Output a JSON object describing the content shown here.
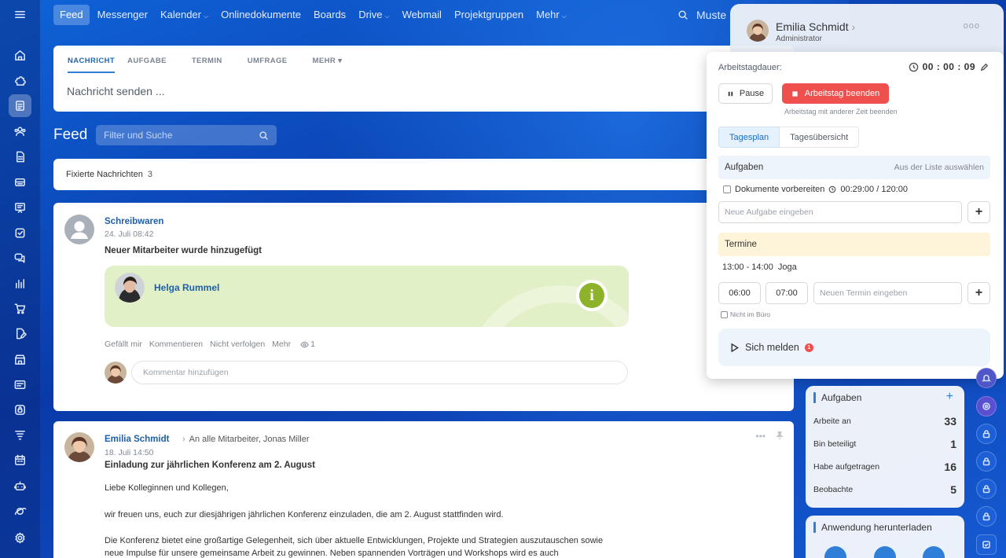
{
  "nav": {
    "items": [
      {
        "label": "Feed",
        "active": true,
        "caret": ""
      },
      {
        "label": "Messenger",
        "caret": ""
      },
      {
        "label": "Kalender",
        "caret": "⌵"
      },
      {
        "label": "Onlinedokumente",
        "caret": ""
      },
      {
        "label": "Boards",
        "caret": ""
      },
      {
        "label": "Drive",
        "caret": "⌵"
      },
      {
        "label": "Webmail",
        "caret": ""
      },
      {
        "label": "Projektgruppen",
        "caret": ""
      },
      {
        "label": "Mehr",
        "caret": "⌵"
      }
    ],
    "search_text": "Muste"
  },
  "composer": {
    "tabs": [
      "NACHRICHT",
      "AUFGABE",
      "TERMIN",
      "UMFRAGE",
      "MEHR ▾"
    ],
    "placeholder": "Nachricht senden ..."
  },
  "feed": {
    "title": "Feed",
    "filter_placeholder": "Filter und Suche",
    "pinned_label": "Fixierte Nachrichten",
    "pinned_count": "3"
  },
  "post1": {
    "author": "Schreibwaren",
    "date": "24. Juli 08:42",
    "title": "Neuer Mitarbeiter wurde hinzugefügt",
    "new_employee": "Helga Rummel",
    "actions": [
      "Gefällt mir",
      "Kommentieren",
      "Nicht verfolgen",
      "Mehr"
    ],
    "views": "1",
    "comment_placeholder": "Kommentar hinzufügen"
  },
  "post2": {
    "author": "Emilia Schmidt",
    "separator": "›",
    "recipients": "An alle Mitarbeiter, Jonas Miller",
    "date": "18. Juli 14:50",
    "title": "Einladung zur jährlichen Konferenz am 2. August",
    "body": [
      "Liebe Kolleginnen und Kollegen,",
      "wir freuen uns, euch zur diesjährigen jährlichen Konferenz einzuladen, die am 2. August stattfinden wird.",
      "Die Konferenz bietet eine großartige Gelegenheit, sich über aktuelle Entwicklungen, Projekte und Strategien auszutauschen sowie",
      "neue Impulse für unsere gemeinsame Arbeit zu gewinnen. Neben spannenden Vorträgen und Workshops wird es auch"
    ]
  },
  "user": {
    "name": "Emilia Schmidt",
    "chevron": "›",
    "role": "Administrator",
    "more": "ooo"
  },
  "workday": {
    "duration_label": "Arbeitstagdauer:",
    "timer": "00 : 00 : 09",
    "pause_label": "Pause",
    "end_label": "Arbeitstag beenden",
    "end_other_time": "Arbeitstag mit anderer Zeit beenden",
    "tabs": [
      "Tagesplan",
      "Tagesübersicht"
    ],
    "tasks_header": "Aufgaben",
    "tasks_link": "Aus der Liste auswählen",
    "task_item": "Dokumente vorbereiten",
    "task_time": "00:29:00 / 120:00",
    "new_task_placeholder": "Neue Aufgabe eingeben",
    "plus": "+",
    "events_header": "Termine",
    "event_time": "13:00 - 14:00",
    "event_name": "Joga",
    "time_from": "06:00",
    "time_to": "07:00",
    "new_event_placeholder": "Neuen Termin eingeben",
    "not_in_office": "Nicht im Büro",
    "checkin_label": "Sich melden",
    "checkin_badge": "1"
  },
  "tasks_widget": {
    "title": "Aufgaben",
    "plus": "+",
    "rows": [
      {
        "label": "Arbeite an",
        "count": "33"
      },
      {
        "label": "Bin beteiligt",
        "count": "1"
      },
      {
        "label": "Habe aufgetragen",
        "count": "16"
      },
      {
        "label": "Beobachte",
        "count": "5"
      }
    ]
  },
  "app_widget": {
    "title": "Anwendung herunterladen"
  },
  "colors": {
    "accent": "#2f7fd8",
    "danger": "#f0504d",
    "success": "#8cb32a"
  },
  "icons": {
    "left_rail": [
      "menu-icon",
      "home-icon",
      "puzzle-icon",
      "feed-icon",
      "team-icon",
      "document-icon",
      "inbox-icon",
      "presentation-icon",
      "checkbox-icon",
      "chat-icon",
      "analytics-icon",
      "cart-icon",
      "sign-icon",
      "store-icon",
      "card-icon",
      "lock-box-icon",
      "filter-icon",
      "calendar-icon",
      "robot-icon",
      "planet-icon",
      "settings-icon"
    ],
    "right_rail": [
      "bell-icon",
      "target-icon",
      "lock-icon",
      "lock-icon",
      "lock-icon",
      "lock-icon",
      "checklist-icon"
    ]
  }
}
